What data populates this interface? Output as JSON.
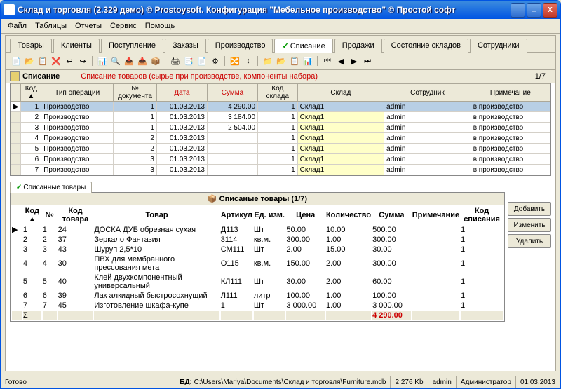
{
  "title": "Склад и торговля (2.329 демо) © Prostoysoft. Конфигурация \"Мебельное производство\" © Простой софт",
  "menu": [
    "Файл",
    "Таблицы",
    "Отчеты",
    "Сервис",
    "Помощь"
  ],
  "tabs": [
    "Товары",
    "Клиенты",
    "Поступление",
    "Заказы",
    "Производство",
    "Списание",
    "Продажи",
    "Состояние складов",
    "Сотрудники"
  ],
  "active_tab": 5,
  "section": {
    "title": "Списание",
    "desc": "Списание товаров (сырье при производстве, компоненты набора)",
    "count": "1/7"
  },
  "cols1": [
    "Код",
    "Тип операции",
    "№ документа",
    "Дата",
    "Сумма",
    "Код склада",
    "Склад",
    "Сотрудник",
    "Примечание"
  ],
  "red_cols1": [
    3,
    4
  ],
  "rows1": [
    {
      "k": "1",
      "op": "Производство",
      "doc": "1",
      "date": "01.03.2013",
      "sum": "4 290.00",
      "kw": "1",
      "wh": "Склад1",
      "emp": "admin",
      "note": "в производство",
      "sel": true
    },
    {
      "k": "2",
      "op": "Производство",
      "doc": "1",
      "date": "01.03.2013",
      "sum": "3 184.00",
      "kw": "1",
      "wh": "Склад1",
      "emp": "admin",
      "note": "в производство"
    },
    {
      "k": "3",
      "op": "Производство",
      "doc": "1",
      "date": "01.03.2013",
      "sum": "2 504.00",
      "kw": "1",
      "wh": "Склад1",
      "emp": "admin",
      "note": "в производство"
    },
    {
      "k": "4",
      "op": "Производство",
      "doc": "2",
      "date": "01.03.2013",
      "sum": "",
      "kw": "1",
      "wh": "Склад1",
      "emp": "admin",
      "note": "в производство"
    },
    {
      "k": "5",
      "op": "Производство",
      "doc": "2",
      "date": "01.03.2013",
      "sum": "",
      "kw": "1",
      "wh": "Склад1",
      "emp": "admin",
      "note": "в производство"
    },
    {
      "k": "6",
      "op": "Производство",
      "doc": "3",
      "date": "01.03.2013",
      "sum": "",
      "kw": "1",
      "wh": "Склад1",
      "emp": "admin",
      "note": "в производство"
    },
    {
      "k": "7",
      "op": "Производство",
      "doc": "3",
      "date": "01.03.2013",
      "sum": "",
      "kw": "1",
      "wh": "Склад1",
      "emp": "admin",
      "note": "в производство"
    }
  ],
  "subtab": "Списанные товары",
  "detail_title": "Списаные товары (1/7)",
  "cols2": [
    "Код",
    "№",
    "Код товара",
    "Товар",
    "Артикул",
    "Ед. изм.",
    "Цена",
    "Количество",
    "Сумма",
    "Примечание",
    "Код списания"
  ],
  "rows2": [
    {
      "k": "1",
      "n": "1",
      "kt": "24",
      "t": "ДОСКА ДУБ обрезная сухая",
      "a": "Д113",
      "u": "Шт",
      "p": "50.00",
      "q": "10.00",
      "s": "500.00",
      "ks": "1",
      "sel": true
    },
    {
      "k": "2",
      "n": "2",
      "kt": "37",
      "t": "Зеркало Фантазия",
      "a": "3114",
      "u": "кв.м.",
      "p": "300.00",
      "q": "1.00",
      "s": "300.00",
      "ks": "1"
    },
    {
      "k": "3",
      "n": "3",
      "kt": "43",
      "t": "Шуруп 2,5*10",
      "a": "СМ111",
      "u": "Шт",
      "p": "2.00",
      "q": "15.00",
      "s": "30.00",
      "ks": "1"
    },
    {
      "k": "4",
      "n": "4",
      "kt": "30",
      "t": "ПВХ для мембранного прессования мета",
      "a": "О115",
      "u": "кв.м.",
      "p": "150.00",
      "q": "2.00",
      "s": "300.00",
      "ks": "1"
    },
    {
      "k": "5",
      "n": "5",
      "kt": "40",
      "t": "Клей двухкомпонентный универсальный",
      "a": "КЛ111",
      "u": "Шт",
      "p": "30.00",
      "q": "2.00",
      "s": "60.00",
      "ks": "1"
    },
    {
      "k": "6",
      "n": "6",
      "kt": "39",
      "t": "Лак алкидный быстросохнущий",
      "a": "Л111",
      "u": "литр",
      "p": "100.00",
      "q": "1.00",
      "s": "100.00",
      "ks": "1"
    },
    {
      "k": "7",
      "n": "7",
      "kt": "45",
      "t": "Изготовление шкафа-купе",
      "a": "1",
      "u": "Шт",
      "p": "3 000.00",
      "q": "1.00",
      "s": "3 000.00",
      "ks": "1"
    }
  ],
  "sum_label": "Σ",
  "sum_val": "4 290.00",
  "btns": {
    "add": "Добавить",
    "edit": "Изменить",
    "del": "Удалить"
  },
  "status": {
    "ready": "Готово",
    "bd_label": "БД:",
    "bd": "C:\\Users\\Mariya\\Documents\\Склад и торговля\\Furniture.mdb",
    "size": "2 276 Kb",
    "user": "admin",
    "role": "Администратор",
    "date": "01.03.2013"
  },
  "icons": [
    "📄",
    "📂",
    "📋",
    "❌",
    "↩",
    "↪",
    "",
    "📊",
    "🔍",
    "📤",
    "📥",
    "📦",
    "",
    "🖨",
    "📑",
    "📄",
    "⚙",
    "",
    "🔀",
    "↕",
    "",
    "📁",
    "📂",
    "📋",
    "📊",
    "",
    "⏮",
    "◀",
    "▶",
    "⏭"
  ]
}
